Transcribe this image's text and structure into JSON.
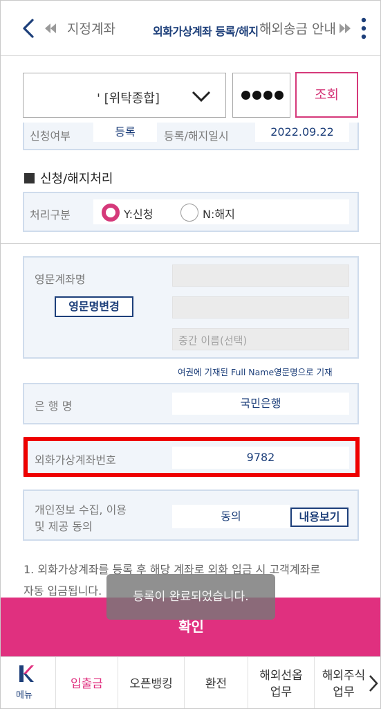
{
  "topnav": {
    "prev_tab": "지정계좌",
    "active_tab": "외화가상계좌 등록/해지",
    "next_tab": "해외송금 안내"
  },
  "account": {
    "select_text": "' [위탁종합]",
    "password_masked": "●●●●",
    "search_label": "조회"
  },
  "status": {
    "apply_label": "신청여부",
    "apply_value": "등록",
    "date_label": "등록/해지일시",
    "date_value": "2022.09.22"
  },
  "process": {
    "section_title": "신청/해지처리",
    "type_label": "처리구분",
    "option_yes": "Y:신청",
    "option_no": "N:해지",
    "selected": "Y"
  },
  "english_name": {
    "label": "영문계좌명",
    "change_button": "영문명변경",
    "field1": "",
    "field2": "",
    "middle_placeholder": "중간 이름(선택)",
    "note": "여권에 기재된 Full Name영문명으로 기재"
  },
  "bank": {
    "label": "은 행 명",
    "value": "국민은행"
  },
  "virtual_account": {
    "label": "외화가상계좌번호",
    "value": "9782"
  },
  "consent": {
    "label_line1": "개인정보 수집, 이용",
    "label_line2": "및 제공 동의",
    "value": "동의",
    "view_button": "내용보기"
  },
  "info": {
    "line1": "1. 외화가상계좌를 등록 후 해당 계좌로 외화 입금 시 고객계좌로",
    "line2": "자동 입금됩니다."
  },
  "confirm_label": "확인",
  "toast": "등록이 완료되었습니다.",
  "bottomnav": {
    "menu_label": "메뉴",
    "items": [
      {
        "label": "입출금"
      },
      {
        "label": "오픈뱅킹"
      },
      {
        "label": "환전"
      },
      {
        "label_line1": "해외선옵",
        "label_line2": "업무"
      },
      {
        "label_line1": "해외주식",
        "label_line2": "업무"
      }
    ]
  },
  "colors": {
    "accent_pink": "#e0307f",
    "navy": "#1d3f7a",
    "highlight_red": "#ee0000"
  }
}
